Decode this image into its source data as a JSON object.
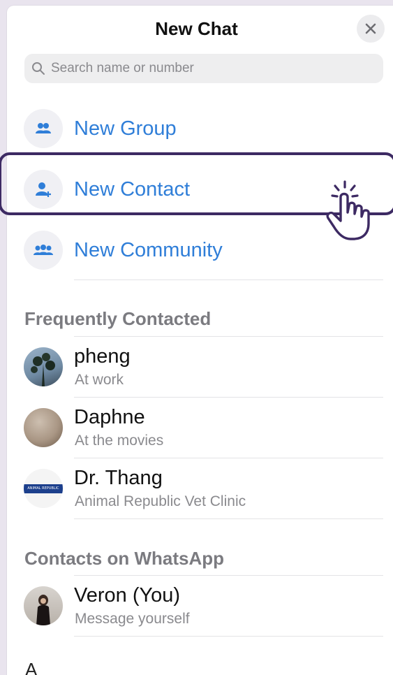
{
  "header": {
    "title": "New Chat",
    "close_icon": "close-icon"
  },
  "search": {
    "placeholder": "Search name or number",
    "icon": "search-icon"
  },
  "actions": [
    {
      "label": "New Group",
      "icon": "group-icon"
    },
    {
      "label": "New Contact",
      "icon": "add-contact-icon",
      "highlighted": true
    },
    {
      "label": "New Community",
      "icon": "community-icon"
    }
  ],
  "sections": {
    "frequent": "Frequently Contacted",
    "contacts": "Contacts on WhatsApp",
    "alpha": "A"
  },
  "frequent_contacts": [
    {
      "name": "pheng",
      "status": "At work"
    },
    {
      "name": "Daphne",
      "status": "At the movies"
    },
    {
      "name": "Dr. Thang",
      "status": "Animal Republic Vet Clinic",
      "avatar_text": "ANIMAL REPUBLIC"
    }
  ],
  "whatsapp_contacts": [
    {
      "name": "Veron (You)",
      "status": "Message yourself"
    }
  ],
  "colors": {
    "accent": "#2f7ed8",
    "highlight_border": "#3d2a63"
  }
}
